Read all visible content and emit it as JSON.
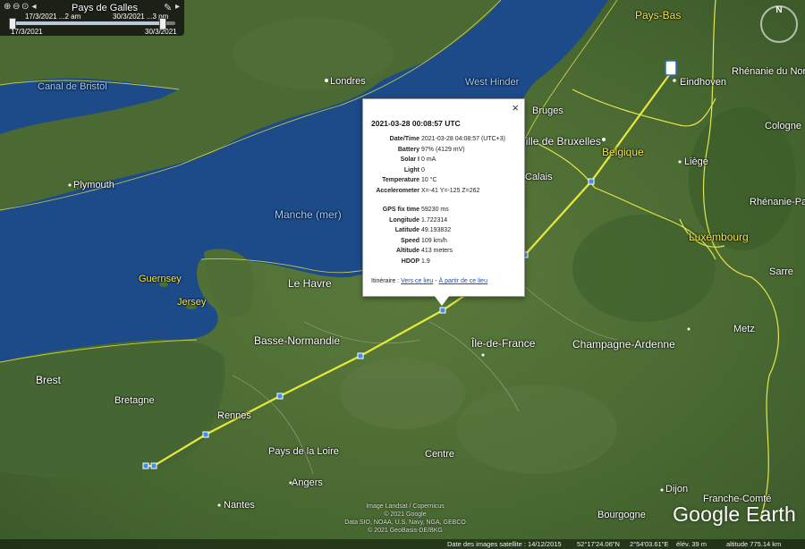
{
  "time_slider": {
    "start_label": "17/3/2021 ...2 am",
    "end_label": "30/3/2021 ...3 pm",
    "start_date": "17/3/2021",
    "end_date": "30/3/2021"
  },
  "compass": {
    "north": "N"
  },
  "map_labels": {
    "pays_de_galles": "Pays de Galles",
    "pays_bas": "Pays-Bas",
    "canal_de_bristol": "Canal de Bristol",
    "londres": "Londres",
    "west_hinder": "West Hinder",
    "eindhoven": "Eindhoven",
    "rhenanie_du_nord": "Rhénanie du Nord",
    "bruges": "Bruges",
    "cologne": "Cologne",
    "ville_de_bruxelles": "Ville de Bruxelles",
    "belgique": "Belgique",
    "liege": "Liège",
    "plymouth": "Plymouth",
    "calais": "Calais",
    "rhenanie_palatinat": "Rhénanie-Pala",
    "manche": "Manche (mer)",
    "luxembourg": "Luxembourg",
    "guernsey": "Guernsey",
    "jersey": "Jersey",
    "le_havre": "Le Havre",
    "sarre": "Sarre",
    "metz": "Metz",
    "basse_normandie": "Basse-Normandie",
    "ile_de_france": "Île-de-France",
    "champagne_ardenne": "Champagne-Ardenne",
    "brest": "Brest",
    "bretagne": "Bretagne",
    "rennes": "Rennes",
    "pays_de_la_loire": "Pays de la Loire",
    "centre": "Centre",
    "angers": "Angers",
    "nantes": "Nantes",
    "dijon": "Dijon",
    "franche_comte": "Franche-Comté",
    "bourgogne": "Bourgogne"
  },
  "popup": {
    "title": "2021-03-28 00:08:57 UTC",
    "close": "×",
    "rows": [
      {
        "k": "Date/Time",
        "v": "2021-03-28 04:08:57 (UTC+3)"
      },
      {
        "k": "Battery",
        "v": "97% (4129 mV)"
      },
      {
        "k": "Solar I",
        "v": "0 mA"
      },
      {
        "k": "Light",
        "v": "0"
      },
      {
        "k": "Temperature",
        "v": "10 °C"
      },
      {
        "k": "Accelerometer",
        "v": "X=-41 Y=-125 Z=262"
      },
      {
        "k": "GPS fix time",
        "v": "59230 ms"
      },
      {
        "k": "Longitude",
        "v": "1.722314"
      },
      {
        "k": "Latitude",
        "v": "49.193832"
      },
      {
        "k": "Speed",
        "v": "109 km/h"
      },
      {
        "k": "Altitude",
        "v": "413 meters"
      },
      {
        "k": "HDOP",
        "v": "1.9"
      }
    ],
    "itinerary_label": "Itinéraire : ",
    "link_to": "Vers ce lieu",
    "separator": " - ",
    "link_from": "À partir de ce lieu"
  },
  "credits": {
    "line1": "Image Landsat / Copernicus",
    "line2": "© 2021 Google",
    "line3": "Data SIO, NOAA, U.S. Navy, NGA, GEBCO",
    "line4": "© 2021 GeoBasis-DE/BKG"
  },
  "logo": "Google Earth",
  "statusbar": {
    "imagery_date": "Date des images satellite : 14/12/2015",
    "lat": "52°17'24.06\"N",
    "lon": "2°54'03.61\"E",
    "elev": "élév.   39 m",
    "altitude": "altitude  775.14 km"
  },
  "colors": {
    "track": "#e8e83a",
    "border": "#e6e64a",
    "sea": "#1c4a8a",
    "land": "#466a30"
  }
}
